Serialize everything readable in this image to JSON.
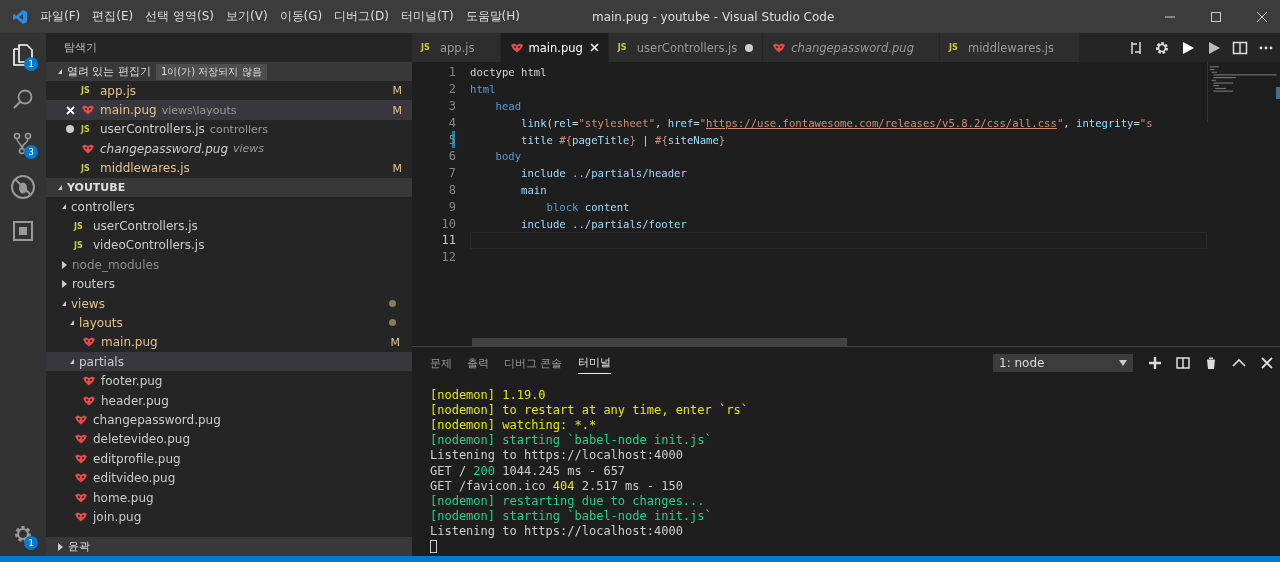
{
  "window": {
    "title": "main.pug - youtube - Visual Studio Code"
  },
  "menu": [
    "파일(F)",
    "편집(E)",
    "선택 영역(S)",
    "보기(V)",
    "이동(G)",
    "디버그(D)",
    "터미널(T)",
    "도움말(H)"
  ],
  "activity_bar": [
    {
      "kind": "files",
      "badge": "1",
      "selected": true
    },
    {
      "kind": "search",
      "selected": false
    },
    {
      "kind": "scm",
      "badge": "3",
      "selected": false
    },
    {
      "kind": "debug",
      "selected": false
    },
    {
      "kind": "extensions",
      "selected": false
    }
  ],
  "settings_badge": "1",
  "sidebar": {
    "title": "탐색기",
    "open_editors": {
      "title": "열려 있는 편집기",
      "badge": "1이(가) 저장되지 않음",
      "expanded": true,
      "items": [
        {
          "name": "app.js",
          "kind": "js",
          "icon_text": "JS",
          "modified": true,
          "status": "M",
          "close_button": false,
          "unsaved": false,
          "italic": false,
          "selected": false
        },
        {
          "name": "main.pug",
          "dir": "views\\layouts",
          "kind": "pug",
          "modified": true,
          "status": "M",
          "close_button": true,
          "unsaved": false,
          "italic": false,
          "selected": true
        },
        {
          "name": "userControllers.js",
          "dir": "controllers",
          "kind": "js",
          "icon_text": "JS",
          "modified": false,
          "close_button": false,
          "unsaved": true,
          "italic": false,
          "selected": false
        },
        {
          "name": "changepassword.pug",
          "dir": "views",
          "kind": "pug",
          "modified": false,
          "close_button": false,
          "unsaved": false,
          "italic": true,
          "selected": false
        },
        {
          "name": "middlewares.js",
          "kind": "js",
          "icon_text": "JS",
          "modified": true,
          "status": "M",
          "close_button": false,
          "unsaved": false,
          "italic": false,
          "selected": false
        }
      ]
    },
    "project": {
      "title": "YOUTUBE",
      "expanded": true,
      "tree": [
        {
          "label": "controllers",
          "kind": "folder",
          "expanded": true,
          "modified": false,
          "ignored": false,
          "dot": false,
          "selected": false,
          "children": [
            {
              "label": "userControllers.js",
              "kind": "js",
              "icon_text": "JS",
              "modified": false,
              "ignored": false,
              "dot": false,
              "selected": false
            },
            {
              "label": "videoControllers.js",
              "kind": "js",
              "icon_text": "JS",
              "modified": false,
              "ignored": false,
              "dot": false,
              "selected": false
            }
          ]
        },
        {
          "label": "node_modules",
          "kind": "folder",
          "expanded": false,
          "modified": false,
          "ignored": true,
          "dot": false,
          "selected": false
        },
        {
          "label": "routers",
          "kind": "folder",
          "expanded": false,
          "modified": false,
          "ignored": false,
          "dot": false,
          "selected": false
        },
        {
          "label": "views",
          "kind": "folder",
          "expanded": true,
          "modified": true,
          "ignored": false,
          "dot": true,
          "selected": false,
          "children": [
            {
              "label": "layouts",
              "kind": "folder",
              "expanded": true,
              "modified": true,
              "ignored": false,
              "dot": true,
              "selected": false,
              "children": [
                {
                  "label": "main.pug",
                  "kind": "pug",
                  "modified": true,
                  "status": "M",
                  "ignored": false,
                  "dot": false,
                  "selected": false
                }
              ]
            },
            {
              "label": "partials",
              "kind": "folder",
              "expanded": true,
              "modified": false,
              "ignored": false,
              "dot": false,
              "selected": true,
              "children": [
                {
                  "label": "footer.pug",
                  "kind": "pug",
                  "modified": false,
                  "ignored": false,
                  "dot": false,
                  "selected": false
                },
                {
                  "label": "header.pug",
                  "kind": "pug",
                  "modified": false,
                  "ignored": false,
                  "dot": false,
                  "selected": false
                }
              ]
            },
            {
              "label": "changepassword.pug",
              "kind": "pug",
              "modified": false,
              "ignored": false,
              "dot": false,
              "selected": false
            },
            {
              "label": "deletevideo.pug",
              "kind": "pug",
              "modified": false,
              "ignored": false,
              "dot": false,
              "selected": false
            },
            {
              "label": "editprofile.pug",
              "kind": "pug",
              "modified": false,
              "ignored": false,
              "dot": false,
              "selected": false
            },
            {
              "label": "editvideo.pug",
              "kind": "pug",
              "modified": false,
              "ignored": false,
              "dot": false,
              "selected": false
            },
            {
              "label": "home.pug",
              "kind": "pug",
              "modified": false,
              "ignored": false,
              "dot": false,
              "selected": false
            },
            {
              "label": "join.pug",
              "kind": "pug",
              "modified": false,
              "ignored": false,
              "dot": false,
              "selected": false
            }
          ]
        }
      ]
    },
    "outline": {
      "title": "윤곽",
      "expanded": false
    }
  },
  "tabs": [
    {
      "label": "app.js",
      "kind": "js",
      "icon_text": "JS",
      "selected": false,
      "italic": false,
      "dirty": false
    },
    {
      "label": "main.pug",
      "kind": "pug",
      "selected": true,
      "italic": false,
      "dirty": false
    },
    {
      "label": "userControllers.js",
      "kind": "js",
      "icon_text": "JS",
      "selected": false,
      "italic": false,
      "dirty": true
    },
    {
      "label": "changepassword.pug",
      "kind": "pug",
      "selected": false,
      "italic": true,
      "dirty": false
    },
    {
      "label": "middlewares.js",
      "kind": "js",
      "icon_text": "JS",
      "selected": false,
      "italic": false,
      "dirty": false
    }
  ],
  "editor_actions": [
    {
      "kind": "compare"
    },
    {
      "kind": "settings"
    },
    {
      "kind": "run"
    },
    {
      "kind": "run-dim"
    },
    {
      "kind": "split"
    },
    {
      "kind": "more"
    }
  ],
  "code": [
    {
      "number": "1",
      "current": false,
      "changed": false,
      "segments": [
        {
          "text": "doctype html",
          "kind": "plain"
        }
      ]
    },
    {
      "number": "2",
      "current": false,
      "changed": false,
      "segments": [
        {
          "text": "html",
          "kind": "keyword"
        }
      ]
    },
    {
      "number": "3",
      "current": false,
      "changed": false,
      "segments": [
        {
          "text": "    head",
          "kind": "keyword"
        }
      ]
    },
    {
      "number": "4",
      "current": false,
      "changed": false,
      "segments": [
        {
          "text": "        link",
          "kind": "tag"
        },
        {
          "text": "(",
          "kind": "plain"
        },
        {
          "text": "rel",
          "kind": "attr"
        },
        {
          "text": "=",
          "kind": "plain"
        },
        {
          "text": "\"stylesheet\"",
          "kind": "string"
        },
        {
          "text": ", ",
          "kind": "plain"
        },
        {
          "text": "href",
          "kind": "attr"
        },
        {
          "text": "=",
          "kind": "plain"
        },
        {
          "text": "\"",
          "kind": "string"
        },
        {
          "text": "https://use.fontawesome.com/releases/v5.8.2/css/all.css",
          "kind": "url"
        },
        {
          "text": "\"",
          "kind": "string"
        },
        {
          "text": ", ",
          "kind": "plain"
        },
        {
          "text": "integrity",
          "kind": "attr"
        },
        {
          "text": "=",
          "kind": "plain"
        },
        {
          "text": "\"s",
          "kind": "string"
        }
      ]
    },
    {
      "number": "5",
      "current": false,
      "changed": true,
      "segments": [
        {
          "text": "        title ",
          "kind": "tag"
        },
        {
          "text": "#{",
          "kind": "string"
        },
        {
          "text": "pageTitle",
          "kind": "tag"
        },
        {
          "text": "}",
          "kind": "string"
        },
        {
          "text": " | ",
          "kind": "plain"
        },
        {
          "text": "#{",
          "kind": "string"
        },
        {
          "text": "siteName",
          "kind": "tag"
        },
        {
          "text": "}",
          "kind": "string"
        }
      ]
    },
    {
      "number": "6",
      "current": false,
      "changed": false,
      "segments": [
        {
          "text": "    body",
          "kind": "keyword"
        }
      ]
    },
    {
      "number": "7",
      "current": false,
      "changed": false,
      "segments": [
        {
          "text": "        include ../partials/header",
          "kind": "tag"
        }
      ]
    },
    {
      "number": "8",
      "current": false,
      "changed": false,
      "segments": [
        {
          "text": "        main",
          "kind": "tag"
        }
      ]
    },
    {
      "number": "9",
      "current": false,
      "changed": false,
      "segments": [
        {
          "text": "            block",
          "kind": "keyword"
        },
        {
          "text": " content",
          "kind": "tag"
        }
      ]
    },
    {
      "number": "10",
      "current": false,
      "changed": false,
      "segments": [
        {
          "text": "        include ../partials/footer",
          "kind": "tag"
        }
      ]
    },
    {
      "number": "11",
      "current": true,
      "changed": false
    },
    {
      "number": "12",
      "current": false,
      "changed": false
    }
  ],
  "panel": {
    "tabs": [
      {
        "label": "문제",
        "selected": false
      },
      {
        "label": "출력",
        "selected": false
      },
      {
        "label": "디버그 콘솔",
        "selected": false
      },
      {
        "label": "터미널",
        "selected": true
      }
    ],
    "terminal_select": "1: node",
    "actions": [
      {
        "kind": "add"
      },
      {
        "kind": "split"
      },
      {
        "kind": "trash"
      },
      {
        "kind": "maximize"
      },
      {
        "kind": "close"
      }
    ],
    "terminal": [
      [
        {
          "text": "[nodemon] 1.19.0",
          "kind": "yellow"
        }
      ],
      [
        {
          "text": "[nodemon] to restart at any time, enter `rs`",
          "kind": "yellow"
        }
      ],
      [
        {
          "text": "[nodemon] watching: *.*",
          "kind": "yellow"
        }
      ],
      [
        {
          "text": "[nodemon] starting `babel-node init.js`",
          "kind": "green"
        }
      ],
      [
        {
          "text": "Listening to https://localhost:4000",
          "kind": "plain"
        }
      ],
      [
        {
          "text": "GET / ",
          "kind": "plain"
        },
        {
          "text": "200",
          "kind": "green"
        },
        {
          "text": " 1044.245 ms - 657",
          "kind": "plain"
        }
      ],
      [
        {
          "text": "GET /favicon.ico ",
          "kind": "plain"
        },
        {
          "text": "404",
          "kind": "yellow"
        },
        {
          "text": " 2.517 ms - 150",
          "kind": "plain"
        }
      ],
      [
        {
          "text": "[nodemon] restarting due to changes...",
          "kind": "green"
        }
      ],
      [
        {
          "text": "[nodemon] starting `babel-node init.js`",
          "kind": "green"
        }
      ],
      [
        {
          "text": "Listening to https://localhost:4000",
          "kind": "plain"
        }
      ]
    ]
  }
}
